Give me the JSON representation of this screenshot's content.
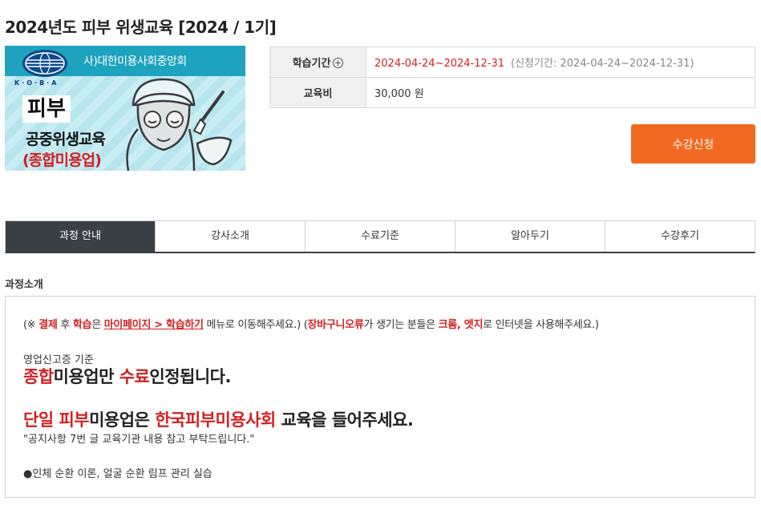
{
  "page": {
    "title": "2024년도 피부 위생교육 [2024 / 1기]"
  },
  "banner": {
    "association": "사)대한미용사회중앙회",
    "logo_text": "K·O·B·A",
    "line1": "피부",
    "line2": "공중위생교육",
    "line3": "(종합미용업)"
  },
  "info": {
    "period_label": "학습기간",
    "period_value": "2024-04-24~2024-12-31",
    "apply_period": "(신청기간: 2024-04-24~2024-12-31)",
    "fee_label": "교육비",
    "fee_value": "30,000 원"
  },
  "enroll_button": "수강신청",
  "tabs": [
    "과정 안내",
    "강사소개",
    "수료기준",
    "알아두기",
    "수강후기"
  ],
  "section_title": "과정소개",
  "content": {
    "notice": {
      "p1": "(※ ",
      "r1": "결제",
      "p2": " 후 ",
      "r2": "학습",
      "p3": "은 ",
      "r3": "마이페이지 > 학습하기",
      "p4": " 메뉴로 이동해주세요.) (",
      "r4": "장바구니오류",
      "p5": "가 생기는 분들은 ",
      "r5": "크롬, 엣지",
      "p6": "로 인터넷을 사용해주세요.)"
    },
    "criteria_label": "영업신고증 기준",
    "big1": {
      "r1": "종합",
      "t1": "미용업만 ",
      "r2": "수료",
      "t2": "인정됩니다."
    },
    "big2": {
      "r1": "단일 피부",
      "t1": "미용업은 ",
      "r2": "한국피부미용사회",
      "t2": " 교육을 들어주세요."
    },
    "quote": "\"공지사항 7번 글 교육기관 내용 참고 부탁드립니다.\"",
    "practice": "●인체 순환 이론, 얼굴 순환 림프 관리 실습"
  },
  "colors": {
    "accent": "#f26a22",
    "red": "#d42020",
    "tab_active": "#3b3f46",
    "banner_blue": "#1da3be"
  }
}
